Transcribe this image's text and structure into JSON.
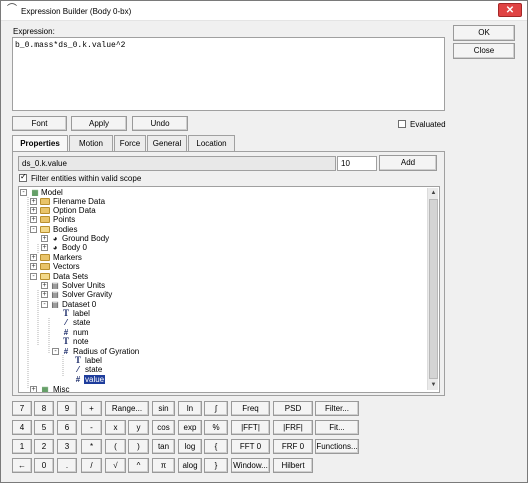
{
  "window": {
    "title": "Expression Builder (Body 0-bx)"
  },
  "dialog_buttons": {
    "ok": "OK",
    "close": "Close"
  },
  "expression": {
    "label": "Expression:",
    "value": "b_0.mass*ds_0.k.value^2"
  },
  "toolbar": {
    "font": "Font",
    "apply": "Apply",
    "undo": "Undo",
    "evaluated_label": "Evaluated",
    "evaluated_checked": false
  },
  "tabs": [
    "Properties",
    "Motion",
    "Force",
    "General",
    "Location"
  ],
  "properties": {
    "entity_path": "ds_0.k.value",
    "count_value": "10",
    "add_label": "Add",
    "filter_label": "Filter entities within valid scope",
    "filter_checked": true
  },
  "tree": [
    {
      "label": "Model",
      "icon": "model-icon",
      "expander": "-"
    },
    {
      "label": "Filename Data",
      "icon": "folder-icon",
      "expander": "+"
    },
    {
      "label": "Option Data",
      "icon": "folder-icon",
      "expander": "+"
    },
    {
      "label": "Points",
      "icon": "folder-icon",
      "expander": "+"
    },
    {
      "label": "Bodies",
      "icon": "folder-icon",
      "expander": "-"
    },
    {
      "label": "Ground Body",
      "icon": "body-icon",
      "expander": "+"
    },
    {
      "label": "Body 0",
      "icon": "body-icon",
      "expander": "+"
    },
    {
      "label": "Markers",
      "icon": "folder-icon",
      "expander": "+"
    },
    {
      "label": "Vectors",
      "icon": "folder-icon",
      "expander": "+"
    },
    {
      "label": "Data Sets",
      "icon": "folder-icon",
      "expander": "-"
    },
    {
      "label": "Solver Units",
      "icon": "dataset-icon",
      "expander": "+"
    },
    {
      "label": "Solver Gravity",
      "icon": "dataset-icon",
      "expander": "+"
    },
    {
      "label": "Dataset 0",
      "icon": "dataset-icon",
      "expander": "-"
    },
    {
      "label": "label",
      "icon": "text-type-icon",
      "glyph": "T",
      "expander": ""
    },
    {
      "label": "state",
      "icon": "boolean-type-icon",
      "glyph": "⁄",
      "expander": ""
    },
    {
      "label": "num",
      "icon": "number-type-icon",
      "glyph": "#",
      "expander": ""
    },
    {
      "label": "note",
      "icon": "text-type-icon",
      "glyph": "T",
      "expander": ""
    },
    {
      "label": "Radius of Gyration",
      "icon": "number-type-icon",
      "glyph": "#",
      "expander": "-"
    },
    {
      "label": "label",
      "icon": "text-type-icon",
      "glyph": "T",
      "expander": ""
    },
    {
      "label": "state",
      "icon": "boolean-type-icon",
      "glyph": "⁄",
      "expander": ""
    },
    {
      "label": "value",
      "icon": "number-type-icon",
      "glyph": "#",
      "expander": "",
      "selected": true
    },
    {
      "label": "Misc",
      "icon": "misc-icon",
      "expander": "+"
    }
  ],
  "keypad": {
    "row1": [
      "7",
      "8",
      "9",
      "+",
      "Range...",
      "sin",
      "ln",
      "∫",
      "Freq",
      "PSD",
      "Filter..."
    ],
    "row2": [
      "4",
      "5",
      "6",
      "-",
      "x",
      "y",
      "cos",
      "exp",
      "%",
      "|FFT|",
      "|FRF|",
      "Fit..."
    ],
    "row3": [
      "1",
      "2",
      "3",
      "*",
      "(",
      ")",
      "tan",
      "log",
      "{",
      "FFT 0",
      "FRF 0",
      "Functions..."
    ],
    "row4": [
      "←",
      "0",
      ".",
      "/",
      "√",
      "^",
      "π",
      "alog",
      "}",
      "Window...",
      "Hilbert"
    ]
  }
}
